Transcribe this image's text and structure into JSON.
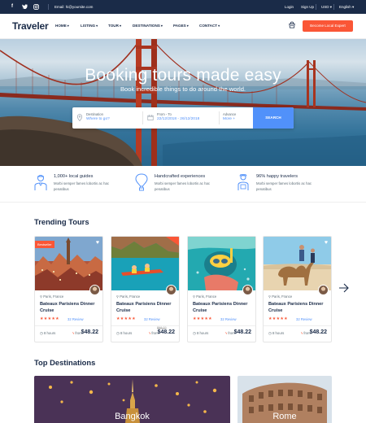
{
  "topbar": {
    "social": [
      "facebook-icon",
      "twitter-icon",
      "instagram-icon"
    ],
    "email": "Email: hi@yoursite.com",
    "links": [
      "Login",
      "Sign Up",
      "USD",
      "English"
    ]
  },
  "nav": {
    "logo": "Traveler",
    "menu": [
      "HOME",
      "LISTING",
      "TOUR",
      "DESTINATIONS",
      "PAGES",
      "CONTACT"
    ],
    "cta": "Become Local Expert"
  },
  "hero": {
    "title": "Booking tours made easy",
    "subtitle": "Book incredible things to do around the world.",
    "search": {
      "destination_label": "Destination",
      "destination_value": "Where to go?",
      "dates_label": "From - To",
      "dates_value": "22/12/2018 - 26/12/2018",
      "advance_label": "Advance",
      "advance_value": "More +",
      "button": "SEARCH"
    }
  },
  "features": [
    {
      "title": "1,000+ local guides",
      "desc": "Morbi semper fames lobortis ac hac penatibus",
      "icon": "guide-icon"
    },
    {
      "title": "Handcrafted experiences",
      "desc": "Morbi semper fames lobortis ac hac penatibus",
      "icon": "balloon-icon"
    },
    {
      "title": "96% happy travelers",
      "desc": "Morbi semper fames lobortis ac hac penatibus",
      "icon": "traveler-icon"
    }
  ],
  "trending": {
    "title": "Trending Tours",
    "cards": [
      {
        "badge": "Bestseller",
        "location": "Paris, France",
        "title": "Bateaux Parisiens Dinner Cruise",
        "reviews": "32 Review",
        "duration": "8 hours",
        "from": "from",
        "old_price": "",
        "price": "$48.22"
      },
      {
        "badge": "",
        "location": "Paris, France",
        "title": "Bateaux Parisiens Dinner Cruise",
        "reviews": "32 Review",
        "duration": "8 hours",
        "from": "from",
        "old_price": "$98.22",
        "price": "$48.22"
      },
      {
        "badge": "",
        "location": "Paris, France",
        "title": "Bateaux Parisiens Dinner Cruise",
        "reviews": "32 Review",
        "duration": "8 hours",
        "from": "from",
        "old_price": "",
        "price": "$48.22"
      },
      {
        "badge": "",
        "location": "Paris, France",
        "title": "Bateaux Parisiens Dinner Cruise",
        "reviews": "32 Review",
        "duration": "8 hours",
        "from": "from",
        "old_price": "",
        "price": "$48.22"
      }
    ],
    "rating_stars": "★★★★★"
  },
  "destinations": {
    "title": "Top Destinations",
    "items": [
      "Bangkok",
      "Rome"
    ]
  },
  "colors": {
    "navy": "#1a2b48",
    "accent_orange": "#fa5636",
    "accent_blue": "#5191fa"
  }
}
